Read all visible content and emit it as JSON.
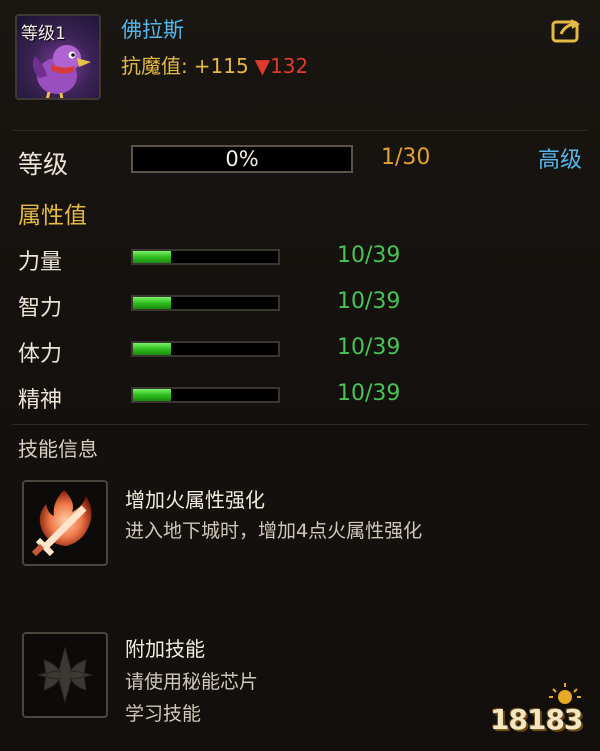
{
  "pet": {
    "level_badge": "等级1",
    "name": "佛拉斯",
    "resist_label": "抗魔值:",
    "resist_value": "+115",
    "resist_down_arrow": "▼",
    "resist_down_value": "132"
  },
  "level": {
    "label": "等级",
    "progress_percent": 0,
    "progress_text": "0%",
    "count": "1/30",
    "advanced_button": "高级"
  },
  "attributes": {
    "header": "属性值",
    "items": [
      {
        "label": "力量",
        "value": "10/39",
        "fill_fraction": 0.26
      },
      {
        "label": "智力",
        "value": "10/39",
        "fill_fraction": 0.26
      },
      {
        "label": "体力",
        "value": "10/39",
        "fill_fraction": 0.26
      },
      {
        "label": "精神",
        "value": "10/39",
        "fill_fraction": 0.26
      }
    ]
  },
  "skills": {
    "header": "技能信息",
    "items": [
      {
        "title": "增加火属性强化",
        "desc_lines": [
          "进入地下城时，增加4点火属性强化"
        ]
      },
      {
        "title": "附加技能",
        "desc_lines": [
          "请使用秘能芯片",
          "学习技能"
        ]
      }
    ]
  },
  "watermark": {
    "text": "18183"
  },
  "icons": {
    "pet_avatar": "bird-avatar-icon",
    "share": "share-icon",
    "fire_skill": "fire-sword-icon",
    "extra_skill": "emblem-icon"
  },
  "colors": {
    "name_blue": "#56b6ea",
    "gold": "#e4b944",
    "green": "#48c455",
    "red": "#e03a2e",
    "orange": "#e2a233"
  }
}
